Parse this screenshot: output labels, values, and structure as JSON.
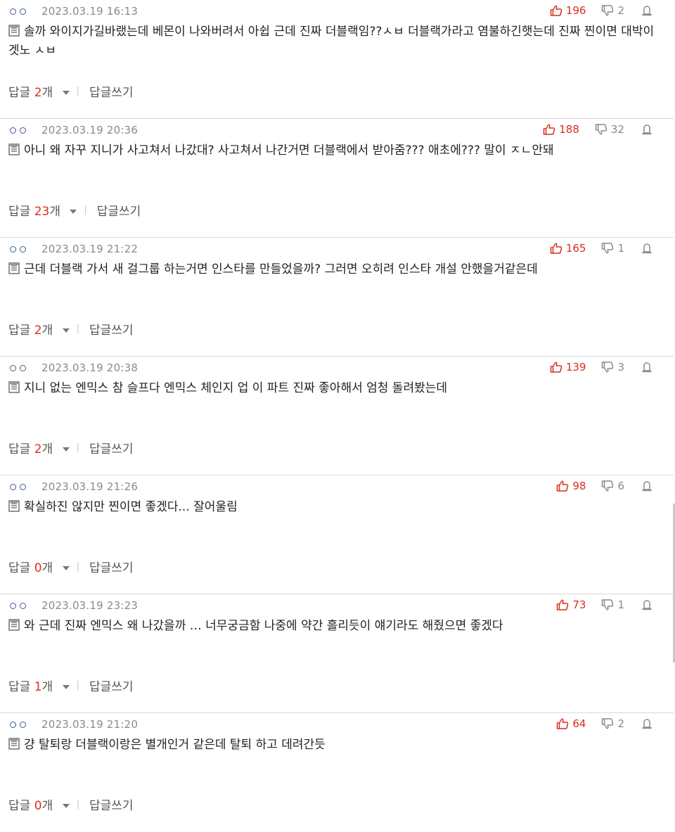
{
  "comments": [
    {
      "date": "2023.03.19 16:13",
      "likes": "196",
      "dislikes": "2",
      "text": "솔까 와이지가길바랬는데 베몬이 나와버려서 아쉽 근데 진짜 더블랙임??ㅅㅂ 더블랙가라고 염불하긴햇는데 진짜 찐이면 대박이겟노 ㅅㅂ",
      "reply_prefix": "답글 ",
      "reply_count": "2",
      "reply_suffix": "개",
      "write_label": "답글쓰기"
    },
    {
      "date": "2023.03.19 20:36",
      "likes": "188",
      "dislikes": "32",
      "text": "아니 왜 자꾸 지니가 사고쳐서 나갔대? 사고쳐서 나간거면 더블랙에서 받아줌??? 애초에??? 말이 ㅈㄴ안돼",
      "reply_prefix": "답글 ",
      "reply_count": "23",
      "reply_suffix": "개",
      "write_label": "답글쓰기"
    },
    {
      "date": "2023.03.19 21:22",
      "likes": "165",
      "dislikes": "1",
      "text": "근데 더블랙 가서 새 걸그룹 하는거면 인스타를 만들었을까? 그러면 오히려 인스타 개설 안했을거같은데",
      "reply_prefix": "답글 ",
      "reply_count": "2",
      "reply_suffix": "개",
      "write_label": "답글쓰기"
    },
    {
      "date": "2023.03.19 20:38",
      "likes": "139",
      "dislikes": "3",
      "text": "지니 없는 엔믹스 참 슬프다 엔믹스 체인지 업 이 파트 진짜 좋아해서 엄청 돌려봤는데",
      "reply_prefix": "답글 ",
      "reply_count": "2",
      "reply_suffix": "개",
      "write_label": "답글쓰기"
    },
    {
      "date": "2023.03.19 21:26",
      "likes": "98",
      "dislikes": "6",
      "text": "확실하진 않지만 찐이면 좋겠다... 잘어울림",
      "reply_prefix": "답글 ",
      "reply_count": "0",
      "reply_suffix": "개",
      "write_label": "답글쓰기"
    },
    {
      "date": "2023.03.19 23:23",
      "likes": "73",
      "dislikes": "1",
      "text": "와 근데 진짜 엔믹스 왜 나갔을까 … 너무궁금함 나중에 약간 흘리듯이 얘기라도 해줬으면 좋겠다",
      "reply_prefix": "답글 ",
      "reply_count": "1",
      "reply_suffix": "개",
      "write_label": "답글쓰기"
    },
    {
      "date": "2023.03.19 21:20",
      "likes": "64",
      "dislikes": "2",
      "text": "걍 탈퇴랑 더블랙이랑은 별개인거 같은데 탈퇴 하고 데려간듯",
      "reply_prefix": "답글 ",
      "reply_count": "0",
      "reply_suffix": "개",
      "write_label": "답글쓰기"
    }
  ],
  "separator": "|",
  "icons": {
    "nick": "user-circles-icon",
    "like": "thumb-up-icon",
    "dislike": "thumb-down-icon",
    "report": "report-icon",
    "memo": "memo-icon",
    "expand": "caret-down-icon"
  },
  "colors": {
    "accent": "#d92e1f",
    "muted": "#8a8a8a",
    "nick": "#3a5d8c"
  }
}
